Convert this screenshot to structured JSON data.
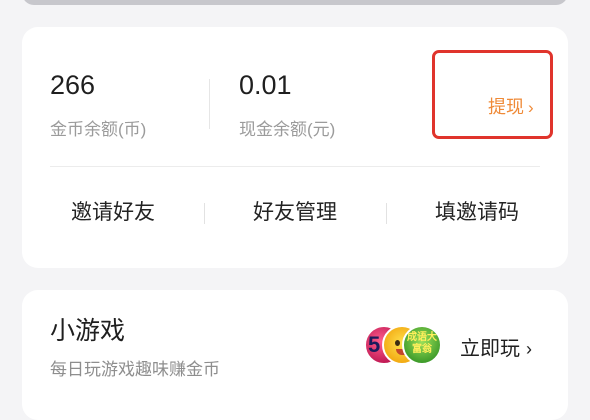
{
  "wallet": {
    "coin_balance": {
      "value": "266",
      "label": "金币余额(币)"
    },
    "cash_balance": {
      "value": "0.01",
      "label": "现金余额(元)"
    },
    "withdraw": {
      "label": "提现",
      "chevron": "›"
    },
    "actions": [
      {
        "label": "邀请好友"
      },
      {
        "label": "好友管理"
      },
      {
        "label": "填邀请码"
      }
    ]
  },
  "mini_games": {
    "title": "小游戏",
    "subtitle": "每日玩游戏趣味赚金币",
    "game_icons": [
      "game-5-icon",
      "smiley-game-icon",
      "idiom-game-icon"
    ],
    "game_icon_texts": [
      "5",
      "成语大富翁"
    ],
    "play_now": {
      "label": "立即玩",
      "chevron": "›"
    }
  },
  "colors": {
    "page_background": "#f4f4f6",
    "card_background": "#ffffff",
    "withdraw_accent": "#ef8a38",
    "highlight_border": "#e0342c",
    "secondary_text": "#9b9b9b"
  }
}
